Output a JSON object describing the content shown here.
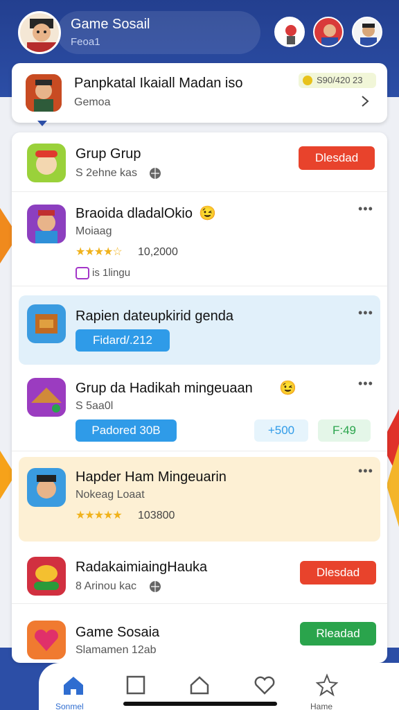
{
  "header": {
    "title": "Game Sosail",
    "subtitle": "Feoa1"
  },
  "top_card": {
    "title": "Panpkatal Ikaiall Madan iso",
    "subtitle": "Gemoa",
    "coins": "S90/420 23"
  },
  "list": {
    "items": [
      {
        "title": "Grup Grup",
        "subtitle": "S 2ehne kas",
        "button": "Dlesdad"
      },
      {
        "title": "Braoida dladalOkio",
        "subtitle": "Moiaag",
        "rating": "10,2000",
        "tag": "is 1lingu"
      },
      {
        "title": "Rapien dateupkirid genda",
        "button": "Fidard/.212"
      },
      {
        "title": "Grup da Hadikah mingeuaan",
        "subtitle": "S 5aa0l",
        "button": "Padored 30B",
        "pill_count": "+500",
        "pill_count_alt": "F:49"
      },
      {
        "title": "Hapder Ham Mingeuarin",
        "subtitle": "Nokeag Loaat",
        "rating": "103800"
      },
      {
        "title": "RadakaimiaingHauka",
        "subtitle": "8 Arinou kac",
        "button": "Dlesdad"
      },
      {
        "title": "Game Sosaia",
        "subtitle": "Slamamen 12ab",
        "button": "Rleadad"
      }
    ]
  },
  "nav": {
    "items": [
      {
        "label": "Sonmel"
      },
      {
        "label": ""
      },
      {
        "label": ""
      },
      {
        "label": ""
      },
      {
        "label": "Hame"
      }
    ]
  },
  "colors": {
    "header_bg": "#233f8f",
    "red": "#e8432c",
    "green": "#2aa44c",
    "blue": "#2f9be8",
    "star": "#f0b21c"
  }
}
